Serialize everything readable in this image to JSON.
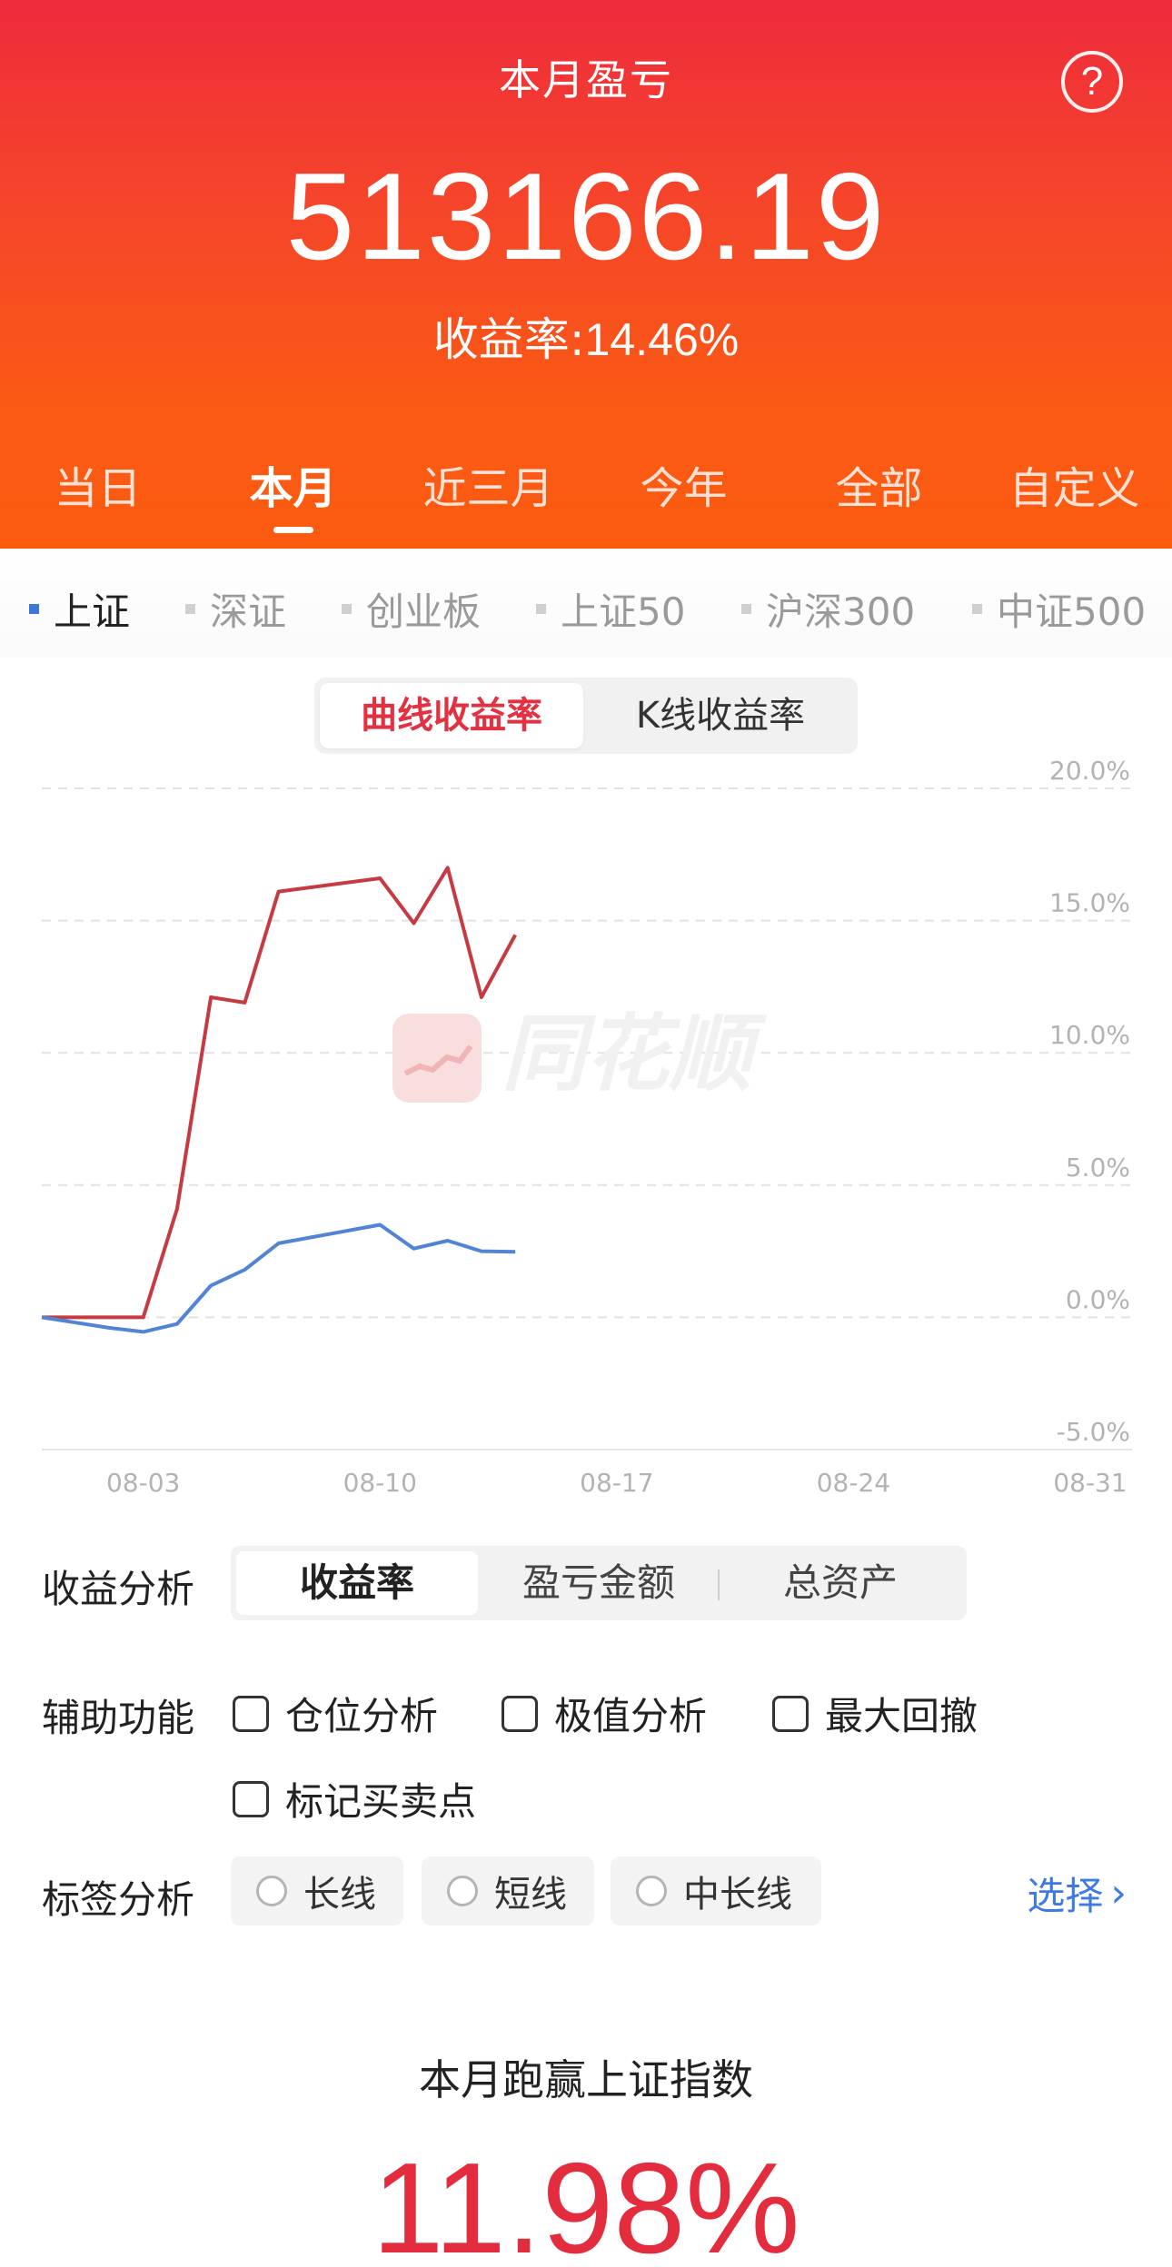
{
  "header": {
    "title": "本月盈亏",
    "help_icon": "?",
    "amount": "513166.19",
    "rate_label": "收益率:",
    "rate_value": "14.46%",
    "colors": {
      "gradient_top": "#ee2b3c",
      "gradient_bottom": "#fb5b0f"
    }
  },
  "period_tabs": [
    {
      "label": "当日",
      "active": false
    },
    {
      "label": "本月",
      "active": true
    },
    {
      "label": "近三月",
      "active": false
    },
    {
      "label": "今年",
      "active": false
    },
    {
      "label": "全部",
      "active": false
    },
    {
      "label": "自定义",
      "active": false
    }
  ],
  "index_tabs": [
    {
      "label": "上证",
      "active": true
    },
    {
      "label": "深证",
      "active": false
    },
    {
      "label": "创业板",
      "active": false
    },
    {
      "label": "上证50",
      "active": false
    },
    {
      "label": "沪深300",
      "active": false
    },
    {
      "label": "中证500",
      "active": false
    }
  ],
  "chart_mode": {
    "options": [
      "曲线收益率",
      "K线收益率"
    ],
    "active": "曲线收益率"
  },
  "watermark": "同花顺",
  "chart_data": {
    "type": "line",
    "x_ticks": [
      "08-03",
      "08-10",
      "08-17",
      "08-24",
      "08-31"
    ],
    "y_ticks": [
      "20.0%",
      "15.0%",
      "10.0%",
      "5.0%",
      "0.0%",
      "-5.0%"
    ],
    "ylim": [
      -5,
      20
    ],
    "grid": true,
    "x": [
      "07-31",
      "08-01",
      "08-02",
      "08-03",
      "08-04",
      "08-05",
      "08-06",
      "08-07",
      "08-10",
      "08-11",
      "08-12",
      "08-13",
      "08-14"
    ],
    "series": [
      {
        "color": "#c63a42",
        "values": [
          0.0,
          0.0,
          0.0,
          0.0,
          4.1,
          12.1,
          11.9,
          16.1,
          16.6,
          14.9,
          17.0,
          12.1,
          14.46
        ]
      },
      {
        "color": "#5184d2",
        "values": [
          0.0,
          -0.2,
          -0.4,
          -0.55,
          -0.25,
          1.2,
          1.8,
          2.8,
          3.5,
          2.6,
          2.9,
          2.5,
          2.48
        ]
      }
    ]
  },
  "analysis": {
    "label": "收益分析",
    "options": [
      "收益率",
      "盈亏金额",
      "总资产"
    ],
    "active": "收益率"
  },
  "aux": {
    "label": "辅助功能",
    "options": [
      "仓位分析",
      "极值分析",
      "最大回撤",
      "标记买卖点"
    ]
  },
  "tags": {
    "label": "标签分析",
    "options": [
      "长线",
      "短线",
      "中长线"
    ],
    "select_label": "选择"
  },
  "beat": {
    "title": "本月跑赢上证指数",
    "value": "11.98%",
    "color": "#e32d3e"
  }
}
